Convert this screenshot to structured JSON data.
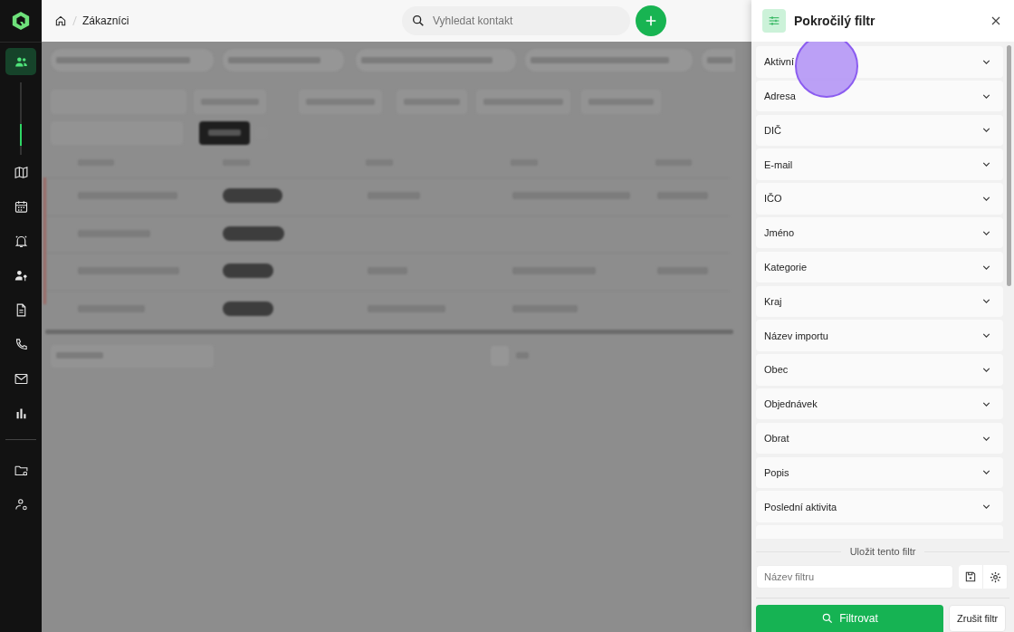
{
  "sidebar": {
    "items": [
      {
        "kind": "users",
        "selected": true
      },
      {
        "kind": "map",
        "selected": false
      },
      {
        "kind": "calendar",
        "selected": false
      },
      {
        "kind": "bell",
        "selected": false
      },
      {
        "kind": "user-key",
        "selected": false
      },
      {
        "kind": "document",
        "selected": false
      },
      {
        "kind": "phone",
        "selected": false
      },
      {
        "kind": "mail",
        "selected": false
      },
      {
        "kind": "chart",
        "selected": false
      }
    ],
    "bottom_items": [
      {
        "kind": "folder-gear",
        "selected": false
      },
      {
        "kind": "users-gear",
        "selected": false
      }
    ]
  },
  "breadcrumb": {
    "current": "Zákazníci"
  },
  "search": {
    "placeholder": "Vyhledat kontakt"
  },
  "panel": {
    "title": "Pokročilý filtr",
    "fields": [
      {
        "label": "Aktivní",
        "expanded": false
      },
      {
        "label": "Adresa",
        "expanded": false
      },
      {
        "label": "DIČ",
        "expanded": false
      },
      {
        "label": "E-mail",
        "expanded": false
      },
      {
        "label": "IČO",
        "expanded": false
      },
      {
        "label": "Jméno",
        "expanded": false
      },
      {
        "label": "Kategorie",
        "expanded": false
      },
      {
        "label": "Kraj",
        "expanded": false
      },
      {
        "label": "Název importu",
        "expanded": false
      },
      {
        "label": "Obec",
        "expanded": false
      },
      {
        "label": "Objednávek",
        "expanded": false
      },
      {
        "label": "Obrat",
        "expanded": false
      },
      {
        "label": "Popis",
        "expanded": false
      },
      {
        "label": "Poslední aktivita",
        "expanded": false
      }
    ],
    "save_label": "Uložit tento filtr",
    "name_field": {
      "placeholder": "Název filtru"
    },
    "apply_button": "Filtrovat",
    "cancel_button": "Zrušit filtr"
  }
}
